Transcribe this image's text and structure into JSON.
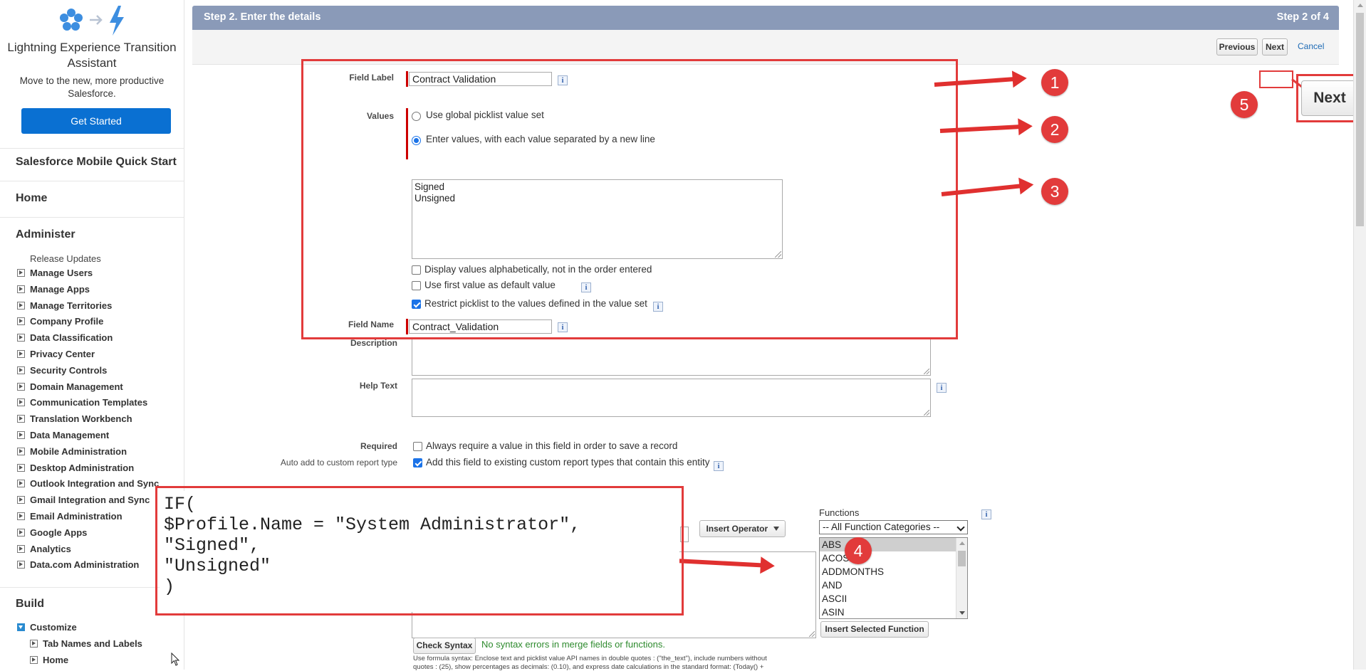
{
  "sidebar": {
    "lex": {
      "title": "Lightning Experience Transition Assistant",
      "subtitle": "Move to the new, more productive Salesforce.",
      "button": "Get Started"
    },
    "mobile_quick_start": "Salesforce Mobile Quick Start",
    "home": "Home",
    "administer": {
      "heading": "Administer",
      "release_updates": "Release Updates",
      "items": [
        "Manage Users",
        "Manage Apps",
        "Manage Territories",
        "Company Profile",
        "Data Classification",
        "Privacy Center",
        "Security Controls",
        "Domain Management",
        "Communication Templates",
        "Translation Workbench",
        "Data Management",
        "Mobile Administration",
        "Desktop Administration",
        "Outlook Integration and Sync",
        "Gmail Integration and Sync",
        "Email Administration",
        "Google Apps",
        "Analytics",
        "Data.com Administration"
      ]
    },
    "build": {
      "heading": "Build",
      "customize": "Customize",
      "sub_items": [
        "Tab Names and Labels",
        "Home"
      ]
    }
  },
  "header": {
    "title": "Step 2. Enter the details",
    "step": "Step 2 of 4"
  },
  "buttons": {
    "previous": "Previous",
    "next": "Next",
    "cancel": "Cancel",
    "next_zoom": "Next"
  },
  "form": {
    "field_label": {
      "label": "Field Label",
      "value": "Contract Validation"
    },
    "values": {
      "label": "Values",
      "option_global": "Use global picklist value set",
      "option_enter": "Enter values, with each value separated by a new line",
      "entered": "Signed\nUnsigned"
    },
    "checkboxes": {
      "alphabetical": "Display values alphabetically, not in the order entered",
      "first_default": "Use first value as default value",
      "restrict": "Restrict picklist to the values defined in the value set"
    },
    "field_name": {
      "label": "Field Name",
      "value": "Contract_Validation"
    },
    "description": {
      "label": "Description"
    },
    "help_text": {
      "label": "Help Text"
    },
    "required": {
      "label": "Required",
      "text": "Always require a value in this field in order to save a record"
    },
    "auto_add": {
      "label": "Auto add to custom report type",
      "text": "Add this field to existing custom report types that contain this entity"
    },
    "info_glyph": "i"
  },
  "formula": {
    "code": "IF(\n$Profile.Name = \"System Administrator\",\n\"Signed\",\n\"Unsigned\"\n)",
    "insert_operator": "Insert Operator",
    "functions_label": "Functions",
    "category_selected": "-- All Function Categories --",
    "functions": [
      "ABS",
      "ACOS",
      "ADDMONTHS",
      "AND",
      "ASCII",
      "ASIN"
    ],
    "insert_selected_function": "Insert Selected Function",
    "check_syntax": "Check Syntax",
    "syntax_status": "No syntax errors in merge fields or functions.",
    "help_line1": "Use formula syntax: Enclose text and picklist value API names in double quotes : (\"the_text\"), include numbers without",
    "help_line2": "quotes : (25), show percentages as decimals: (0.10), and express date calculations in the standard format: (Today() +"
  },
  "annotations": {
    "b1": "1",
    "b2": "2",
    "b3": "3",
    "b4": "4",
    "b5": "5"
  },
  "colors": {
    "accent_blue": "#0a70d2",
    "header": "#8a9ab8",
    "annotation_red": "#e23b3b"
  }
}
